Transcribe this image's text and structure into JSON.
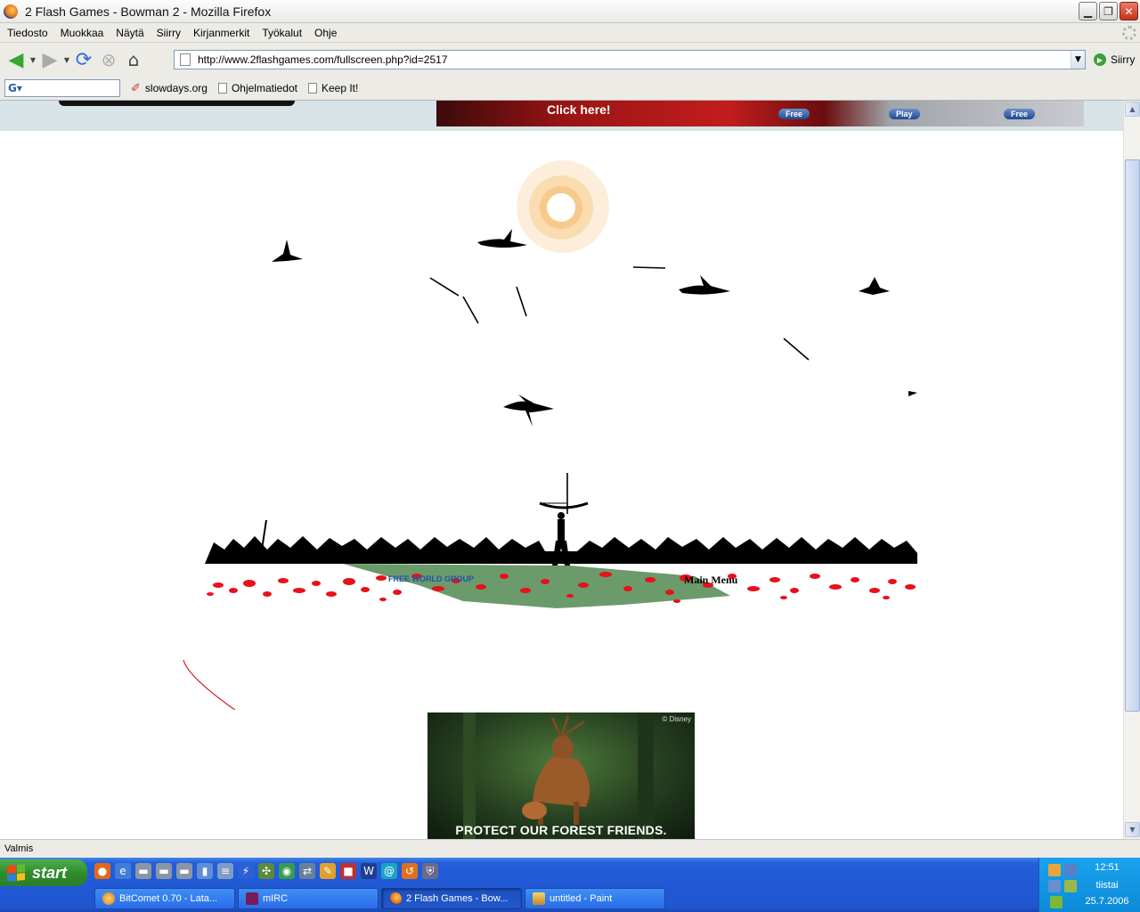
{
  "window": {
    "title": "2 Flash Games - Bowman 2 - Mozilla Firefox",
    "buttons": [
      "minimize",
      "maximize",
      "close"
    ]
  },
  "menubar": {
    "items": [
      "Tiedosto",
      "Muokkaa",
      "Näytä",
      "Siirry",
      "Kirjanmerkit",
      "Työkalut",
      "Ohje"
    ]
  },
  "navbar": {
    "url": "http://www.2flashgames.com/fullscreen.php?id=2517",
    "go_label": "Siirry",
    "icons": [
      "back-icon",
      "forward-icon",
      "reload-icon",
      "stop-icon",
      "home-icon"
    ]
  },
  "bookmarks": {
    "search_value": "",
    "items": [
      "slowdays.org",
      "Ohjelmatiedot",
      "Keep It!"
    ]
  },
  "page": {
    "banner": {
      "click_label": "Click here!",
      "buttons": [
        "Free",
        "Play",
        "Free"
      ]
    },
    "game": {
      "sponsor_label": "FREE WORLD GROUP",
      "main_menu_label": "Main Menu"
    },
    "ad": {
      "copyright": "© Disney",
      "tagline": "PROTECT OUR FOREST FRIENDS."
    }
  },
  "statusbar": {
    "text": "Valmis"
  },
  "taskbar": {
    "start_label": "start",
    "tasks": [
      {
        "label": "BitComet 0.70 - Lata...",
        "active": false
      },
      {
        "label": "mIRC",
        "active": false
      },
      {
        "label": "2 Flash Games - Bow...",
        "active": true
      },
      {
        "label": "untitled - Paint",
        "active": false
      }
    ],
    "clock": {
      "time": "12:51",
      "day": "tiistai",
      "date": "25.7.2006"
    }
  },
  "colors": {
    "taskbar_blue": "#245edb",
    "start_green": "#3c9a39",
    "blood_red": "#e8101a",
    "grass_green": "#6b9b6b",
    "annotation_red": "#d42020"
  }
}
